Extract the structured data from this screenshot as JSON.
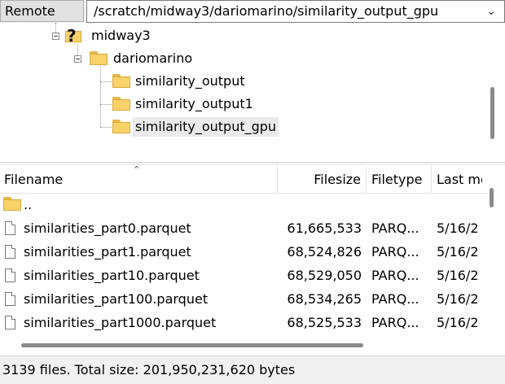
{
  "remote_site": {
    "label": "Remote site:",
    "path": "/scratch/midway3/dariomarino/similarity_output_gpu"
  },
  "tree": {
    "nodes": [
      {
        "name": "midway3",
        "icon": "question-folder-icon"
      },
      {
        "name": "dariomarino",
        "icon": "folder-icon"
      },
      {
        "name": "similarity_output",
        "icon": "folder-icon"
      },
      {
        "name": "similarity_output1",
        "icon": "folder-icon"
      },
      {
        "name": "similarity_output_gpu",
        "icon": "folder-icon",
        "selected": true
      }
    ]
  },
  "file_list": {
    "columns": {
      "filename": "Filename",
      "filesize": "Filesize",
      "filetype": "Filetype",
      "last_modified": "Last mo"
    },
    "parent_dir": "..",
    "rows": [
      {
        "name": "similarities_part0.parquet",
        "size": "61,665,533",
        "type": "PARQ...",
        "modified": "5/16/2"
      },
      {
        "name": "similarities_part1.parquet",
        "size": "68,524,826",
        "type": "PARQ...",
        "modified": "5/16/2"
      },
      {
        "name": "similarities_part10.parquet",
        "size": "68,529,050",
        "type": "PARQ...",
        "modified": "5/16/2"
      },
      {
        "name": "similarities_part100.parquet",
        "size": "68,534,265",
        "type": "PARQ...",
        "modified": "5/16/2"
      },
      {
        "name": "similarities_part1000.parquet",
        "size": "68,525,533",
        "type": "PARQ...",
        "modified": "5/16/2"
      }
    ]
  },
  "status": {
    "text": "3139 files. Total size: 201,950,231,620 bytes"
  }
}
